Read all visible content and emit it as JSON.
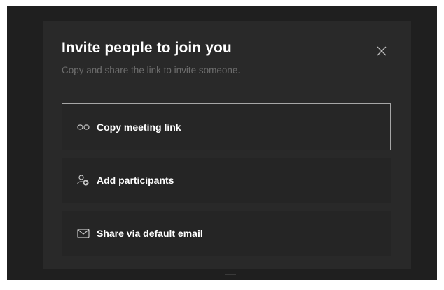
{
  "dialog": {
    "title": "Invite people to join you",
    "subtitle": "Copy and share the link to invite someone."
  },
  "options": [
    {
      "label": "Copy meeting link",
      "icon": "link-icon",
      "selected": true
    },
    {
      "label": "Add participants",
      "icon": "add-people-icon",
      "selected": false
    },
    {
      "label": "Share via default email",
      "icon": "mail-icon",
      "selected": false
    }
  ],
  "icons": {
    "close": "close-icon"
  },
  "colors": {
    "dialog_background": "#292929",
    "outer_background": "#1f1f1f",
    "option_background": "#252525",
    "selected_border": "#a6a6a6",
    "title": "#ffffff",
    "subtitle": "#6d6d6d"
  }
}
